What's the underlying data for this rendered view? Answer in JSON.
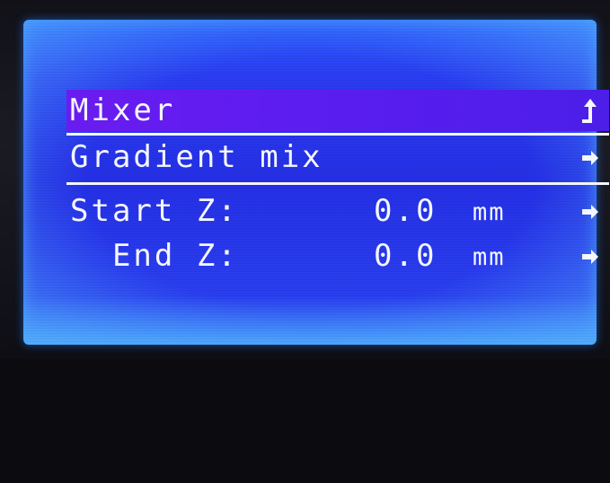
{
  "menu": {
    "title": "Mixer",
    "back_icon": "up-arrow-icon",
    "items": [
      {
        "label": "Gradient mix",
        "icon": "right-arrow-icon"
      },
      {
        "label": "Start Z:",
        "value": "0.0",
        "unit": "mm",
        "icon": "right-arrow-icon"
      },
      {
        "label": "  End Z:",
        "value": "0.0",
        "unit": "mm",
        "icon": "right-arrow-icon"
      }
    ]
  },
  "colors": {
    "backlight": "#2530e6",
    "header_highlight": "#5a1df0",
    "text": "#f4f6ff"
  }
}
